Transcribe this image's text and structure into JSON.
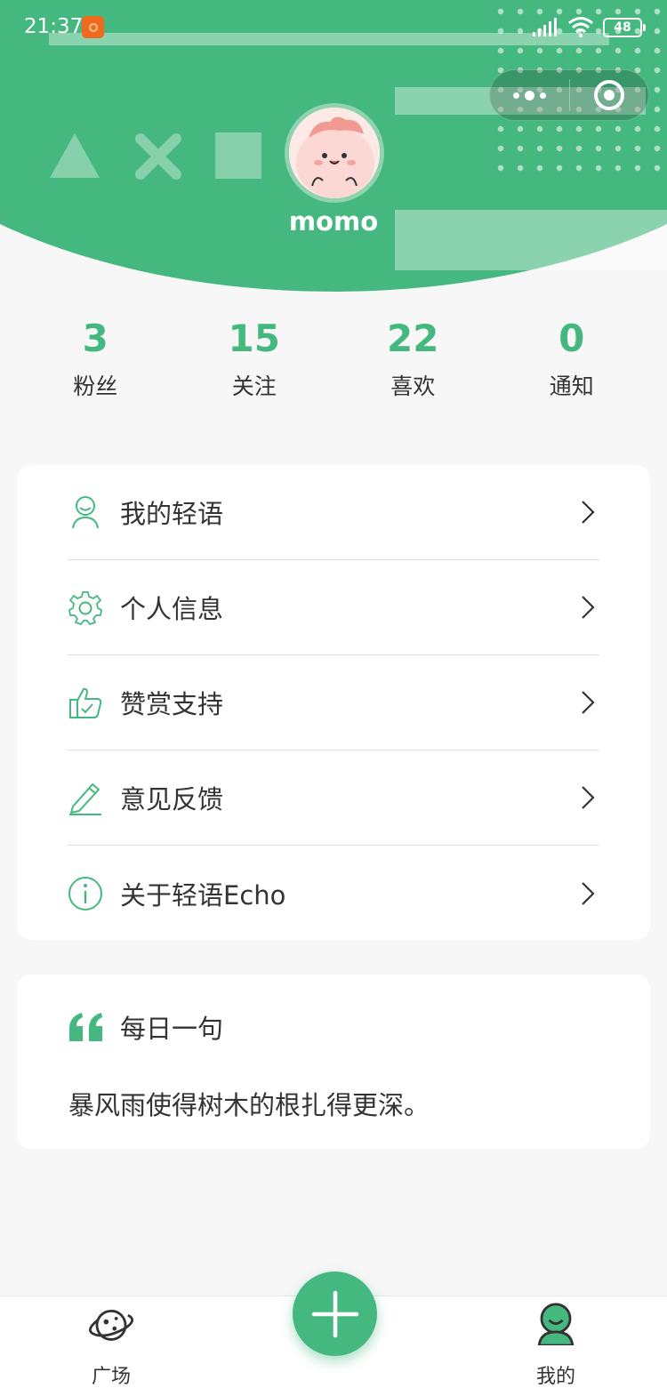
{
  "status_bar": {
    "time": "21:37",
    "battery": "48"
  },
  "header": {
    "username": "momo",
    "accent_color": "#45b87f"
  },
  "stats": [
    {
      "value": "3",
      "label": "粉丝"
    },
    {
      "value": "15",
      "label": "关注"
    },
    {
      "value": "22",
      "label": "喜欢"
    },
    {
      "value": "0",
      "label": "通知"
    }
  ],
  "menu": [
    {
      "label": "我的轻语",
      "icon": "user-icon"
    },
    {
      "label": "个人信息",
      "icon": "gear-icon"
    },
    {
      "label": "赞赏支持",
      "icon": "thumbs-up-icon"
    },
    {
      "label": "意见反馈",
      "icon": "pencil-icon"
    },
    {
      "label": "关于轻语Echo",
      "icon": "info-icon"
    }
  ],
  "daily_quote": {
    "title": "每日一句",
    "text": "暴风雨使得树木的根扎得更深。"
  },
  "tabbar": {
    "left_label": "广场",
    "left_icon": "planet-icon",
    "center_icon": "plus-icon",
    "right_label": "我的",
    "right_icon": "profile-icon"
  }
}
